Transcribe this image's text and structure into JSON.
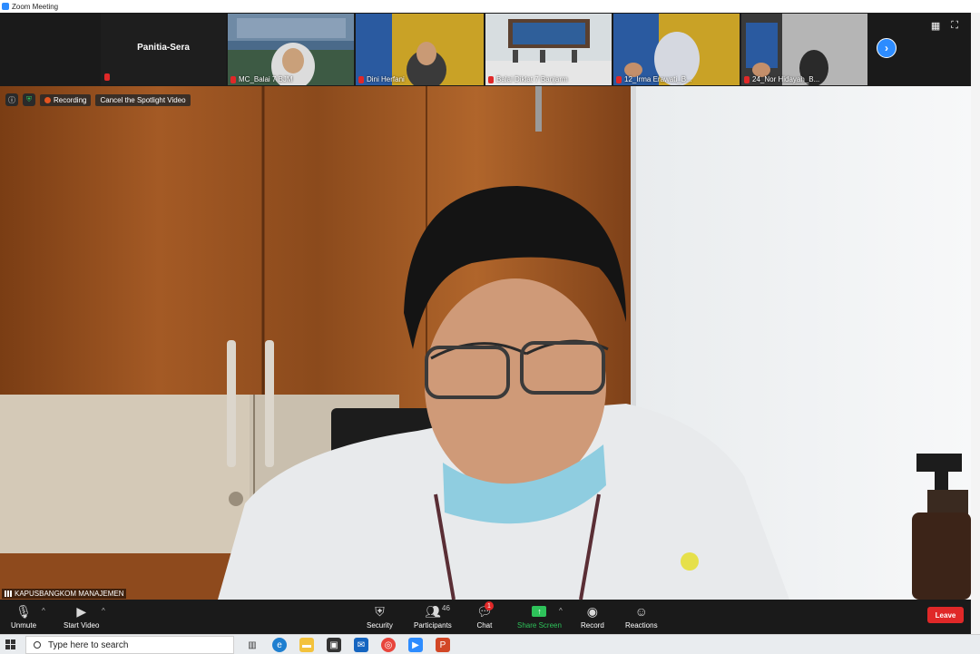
{
  "window": {
    "title": "Zoom Meeting"
  },
  "strip": {
    "name_tile": "Panitia-Sera",
    "tiles": [
      {
        "label": "MC_Balai 7 BJM"
      },
      {
        "label": "Dini Herfani"
      },
      {
        "label": "Balai Diklat 7 Banjarm"
      },
      {
        "label": "12_Irma Erawati_B..."
      },
      {
        "label": "24_Nor Hidayah_B..."
      }
    ]
  },
  "overlay": {
    "recording": "Recording",
    "cancel_spotlight": "Cancel the Spotlight Video"
  },
  "video": {
    "speaker_name": "KAPUSBANGKOM MANAJEMEN"
  },
  "controls": {
    "unmute": "Unmute",
    "start_video": "Start Video",
    "security": "Security",
    "participants": "Participants",
    "participants_count": "46",
    "chat": "Chat",
    "chat_badge": "1",
    "share_screen": "Share Screen",
    "record": "Record",
    "reactions": "Reactions",
    "leave": "Leave"
  },
  "taskbar": {
    "search_placeholder": "Type here to search"
  },
  "colors": {
    "zoom_blue": "#2d8cff",
    "share_green": "#2ec25a",
    "leave_red": "#e02828",
    "wood": "#8a4a1f"
  }
}
